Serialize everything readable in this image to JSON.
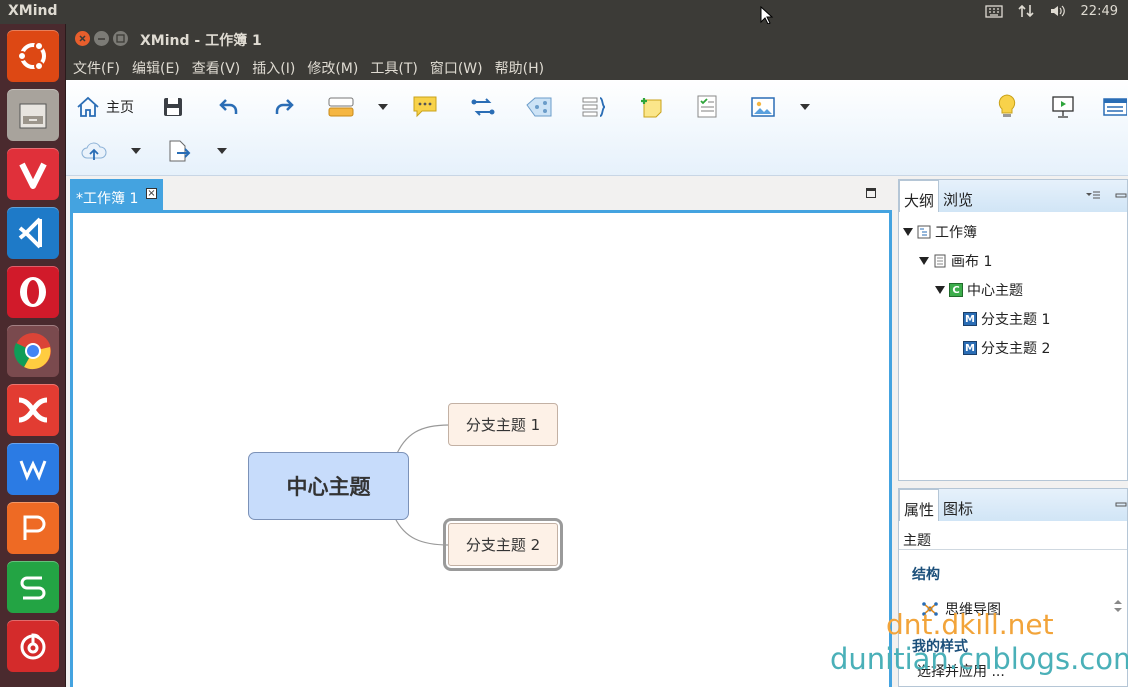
{
  "top_panel": {
    "app_name": "XMind",
    "clock": "22:49"
  },
  "window": {
    "title": "XMind - 工作簿 1"
  },
  "menu": [
    "文件(F)",
    "编辑(E)",
    "查看(V)",
    "插入(I)",
    "修改(M)",
    "工具(T)",
    "窗口(W)",
    "帮助(H)"
  ],
  "toolbar": {
    "home_label": "主页"
  },
  "editor": {
    "tab_label": "*工作簿 1"
  },
  "mindmap": {
    "central": "中心主题",
    "branches": [
      "分支主题 1",
      "分支主题 2"
    ]
  },
  "outline_panel": {
    "tabs": [
      "大纲",
      "浏览"
    ],
    "tree": {
      "workbook": "工作簿",
      "sheet": "画布 1",
      "central": "中心主题",
      "branch1": "分支主题 1",
      "branch2": "分支主题 2"
    }
  },
  "props_panel": {
    "tabs": [
      "属性",
      "图标"
    ],
    "subject": "主题",
    "structure_heading": "结构",
    "structure_value": "思维导图",
    "my_style_heading": "我的样式",
    "style_select": "选择并应用 ..."
  },
  "watermarks": {
    "line1": "dnt.dkill.net",
    "line2": "dunitian.cnblogs.com"
  },
  "colors": {
    "accent_blue": "#44a3e0",
    "central_fill": "#c7dcfb",
    "branch_fill": "#fdf1e7",
    "launcher_bg": "#4a2a2e"
  }
}
